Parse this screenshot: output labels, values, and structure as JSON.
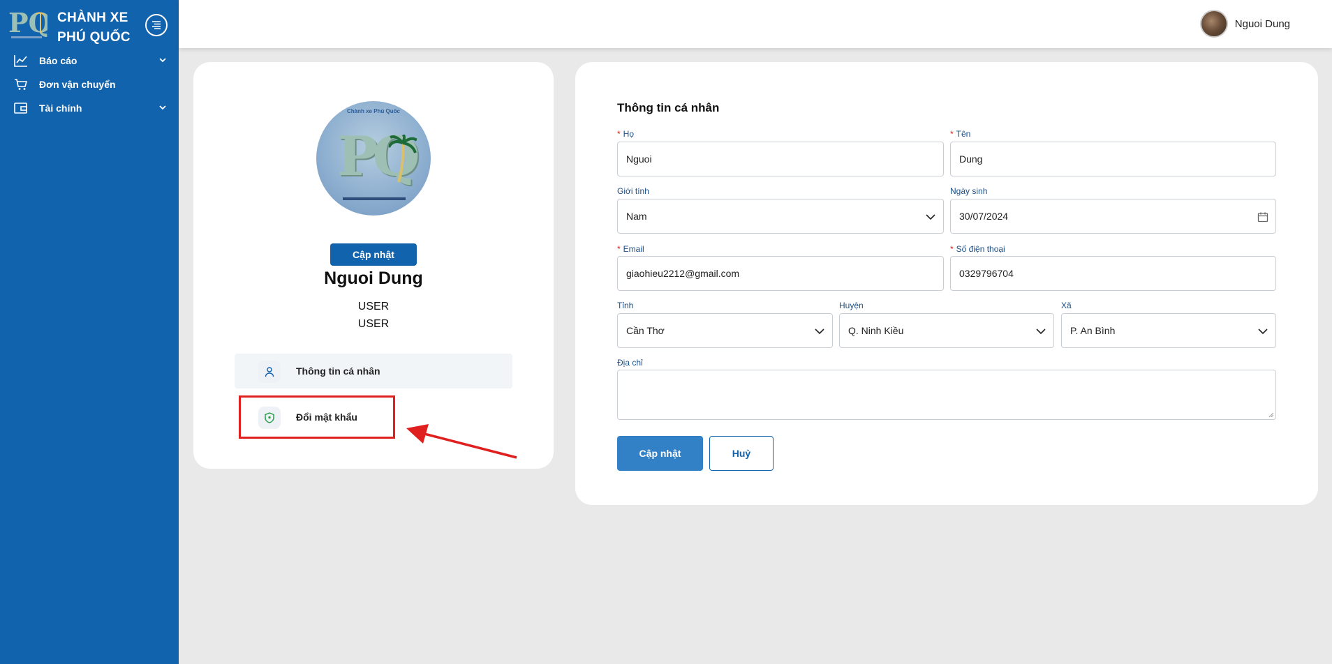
{
  "brand": {
    "title_line1": "CHÀNH XE",
    "title_line2": "PHÚ QUỐC",
    "logo_text": "PQ"
  },
  "sidebar": {
    "items": [
      {
        "label": "Báo cáo",
        "icon": "chart-line-icon",
        "expandable": true
      },
      {
        "label": "Đơn vận chuyển",
        "icon": "cart-icon",
        "expandable": false
      },
      {
        "label": "Tài chính",
        "icon": "wallet-icon",
        "expandable": true
      }
    ]
  },
  "header": {
    "user_name": "Nguoi Dung"
  },
  "profile": {
    "picture_caption": "Chành xe Phú Quốc",
    "picture_letters": "PQ",
    "update_label": "Cập nhật",
    "name": "Nguoi Dung",
    "roles": [
      "USER",
      "USER"
    ],
    "links": [
      {
        "label": "Thông tin cá nhân",
        "icon": "user-icon",
        "active": true
      },
      {
        "label": "Đổi mật khẩu",
        "icon": "shield-icon",
        "active": false
      }
    ]
  },
  "form": {
    "title": "Thông tin cá nhân",
    "ho": {
      "label": "Họ",
      "required": true,
      "value": "Nguoi"
    },
    "ten": {
      "label": "Tên",
      "required": true,
      "value": "Dung"
    },
    "gioi_tinh": {
      "label": "Giới tính",
      "value": "Nam"
    },
    "ngay_sinh": {
      "label": "Ngày sinh",
      "value": "30/07/2024"
    },
    "email": {
      "label": "Email",
      "required": true,
      "value": "giaohieu2212@gmail.com"
    },
    "so_dien_thoai": {
      "label": "Số điện thoại",
      "required": true,
      "value": "0329796704"
    },
    "tinh": {
      "label": "Tỉnh",
      "value": "Cần Thơ"
    },
    "huyen": {
      "label": "Huyện",
      "value": "Q. Ninh Kiều"
    },
    "xa": {
      "label": "Xã",
      "value": "P. An Bình"
    },
    "dia_chi": {
      "label": "Địa chỉ",
      "value": ""
    },
    "submit_label": "Cập nhật",
    "cancel_label": "Huỷ"
  },
  "colors": {
    "sidebar": "#1263ad",
    "primary_button": "#3280c5",
    "annotation": "#e01f1f",
    "label": "#1b4f86",
    "required": "#e02020"
  }
}
